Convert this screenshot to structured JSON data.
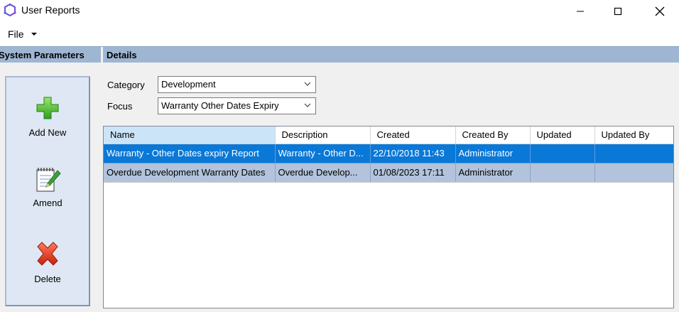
{
  "window": {
    "title": "User Reports",
    "icon": "app-logo-icon"
  },
  "menu": {
    "file_label": "File"
  },
  "header": {
    "left_title": "System Parameters",
    "right_title": "Details"
  },
  "toolbar": {
    "items": [
      {
        "label": "Add New",
        "icon": "add-plus-icon"
      },
      {
        "label": "Amend",
        "icon": "notepad-pencil-icon"
      },
      {
        "label": "Delete",
        "icon": "delete-x-icon"
      }
    ]
  },
  "filters": {
    "category_label": "Category",
    "category_value": "Development",
    "focus_label": "Focus",
    "focus_value": "Warranty Other Dates Expiry"
  },
  "grid": {
    "columns": [
      "Name",
      "Description",
      "Created",
      "Created By",
      "Updated",
      "Updated By"
    ],
    "rows": [
      {
        "name": "Warranty - Other Dates expiry Report",
        "description": "Warranty - Other D...",
        "created": "22/10/2018 11:43",
        "created_by": "Administrator",
        "updated": "",
        "updated_by": ""
      },
      {
        "name": "Overdue Development Warranty Dates",
        "description": "Overdue Develop...",
        "created": "01/08/2023 17:11",
        "created_by": "Administrator",
        "updated": "",
        "updated_by": ""
      }
    ]
  },
  "colors": {
    "header_bar": "#9fb6d2",
    "selected_row": "#0a78d7",
    "alt_row": "#b2c3db",
    "toolbar_bg": "#dfe7f4"
  }
}
